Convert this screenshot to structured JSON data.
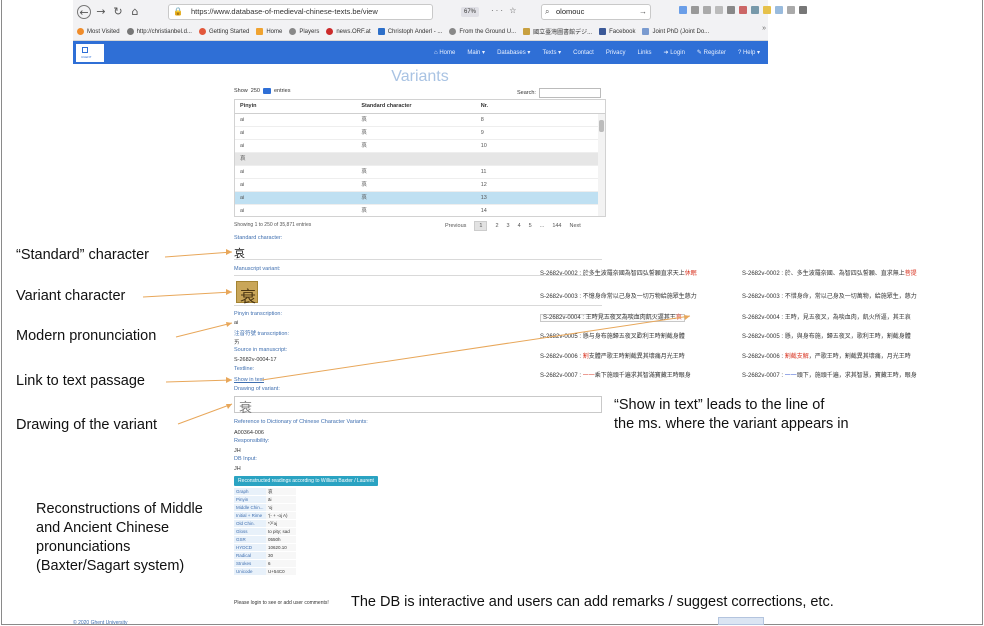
{
  "browser": {
    "url": "https://www.database-of-medieval-chinese-texts.be/view",
    "zoom": "67%",
    "search_value": "olomouc",
    "bookmarks": [
      "Most Visited",
      "http://christianbel.d...",
      "Getting Started",
      "Home",
      "Players",
      "news.ORF.at",
      "Christoph Anderl - ...",
      "From the Ground U...",
      "國立臺灣圖書館デジ...",
      "Facebook",
      "Joint PhD (Joint Do..."
    ]
  },
  "site_nav": {
    "items": [
      "Home",
      "Main",
      "Databases",
      "Texts",
      "Contact",
      "Privacy",
      "Links",
      "Login",
      "Register",
      "Help"
    ]
  },
  "page_title": "Variants",
  "datatable": {
    "show_label": "Show",
    "show_value": "250",
    "entries_label": "entries",
    "search_label": "Search:",
    "headers": [
      "Pinyin",
      "Standard character",
      "Nr."
    ],
    "rows": [
      {
        "pinyin": "ai",
        "char": "哀",
        "nr": "8"
      },
      {
        "pinyin": "ai",
        "char": "哀",
        "nr": "9"
      },
      {
        "pinyin": "ai",
        "char": "哀",
        "nr": "10"
      },
      {
        "pinyin": "哀",
        "char": "",
        "nr": ""
      },
      {
        "pinyin": "ai",
        "char": "哀",
        "nr": "11"
      },
      {
        "pinyin": "ai",
        "char": "哀",
        "nr": "12"
      },
      {
        "pinyin": "ai",
        "char": "哀",
        "nr": "13"
      },
      {
        "pinyin": "ai",
        "char": "哀",
        "nr": "14"
      }
    ],
    "info": "Showing 1 to 250 of 35,871 entries",
    "pager": [
      "Previous",
      "1",
      "2",
      "3",
      "4",
      "5",
      "...",
      "144",
      "Next"
    ]
  },
  "detail": {
    "standard_char_label": "Standard character:",
    "standard_char": "哀",
    "ms_variant_label": "Manuscript variant:",
    "ms_variant_char": "衰",
    "pinyin_label": "Pinyin transcription:",
    "pinyin_value": "ai",
    "zhuyin_label": "注音符號 transcription:",
    "zhuyin_value": "ㄞ",
    "source_label": "Source in manuscript:",
    "source_value": "S-2682v-0004-17",
    "textline_label": "Textline:",
    "show_in_text": "Show in text",
    "drawing_label": "Drawing of variant:",
    "drawing_char": "衰",
    "reference_label": "Reference to Dictionary of Chinese Character Variants:",
    "reference_value": "A00364-006",
    "responsibility_label": "Responsibility:",
    "responsibility_value": "JH",
    "db_input_label": "DB Input:",
    "db_input_value": "JH",
    "recon_button": "Reconstructed readings according to William Baxter / Laurent Sagart",
    "recon_rows": [
      {
        "k": "Graph",
        "v": "哀"
      },
      {
        "k": "Pinyin",
        "v": "āi"
      },
      {
        "k": "Middle Chin...",
        "v": "'oj"
      },
      {
        "k": "Initial + Rime",
        "v": "'(- + -oj A)"
      },
      {
        "k": "Old Chin.",
        "v": "*ʔˤəj"
      },
      {
        "k": "Gloss",
        "v": "to pity; sad"
      },
      {
        "k": "GSR",
        "v": "0550h"
      },
      {
        "k": "HYDCD",
        "v": "10620.10"
      },
      {
        "k": "Radical",
        "v": "30"
      },
      {
        "k": "Strokes",
        "v": "6"
      },
      {
        "k": "Unicode",
        "v": "U+54C0"
      }
    ],
    "login_note": "Please login to see or add user comments!"
  },
  "footer": {
    "left": "© 2020 Ghent University"
  },
  "passages_left": [
    {
      "id": "S-2682v-0002",
      "text": "於多生波羅奈國為智四弘誓願直求天上",
      "mark": "休眠",
      "color": "red"
    },
    {
      "id": "S-2682v-0003",
      "text": "不憶身命常以己身及一切万物給施眾生慈力",
      "mark": "",
      "color": ""
    },
    {
      "id": "S-2682v-0004",
      "text": "王時見五夜叉為啖血肉飢火逼其王",
      "mark": "哀",
      "color": "red"
    },
    {
      "id": "S-2682v-0005",
      "text": "懸与身布施歸五夜叉歡利王時割截身體",
      "mark": "",
      "color": ""
    },
    {
      "id": "S-2682v-0006",
      "text": "支體",
      "pre": "割",
      "rest": "严歌王時割截異其壞痛月光王時",
      "color": "red"
    },
    {
      "id": "S-2682v-0007",
      "text": "乘下施頭千遍求其智滿寶藏王時眼身",
      "pre": "一一",
      "color": "red"
    }
  ],
  "passages_right": [
    {
      "id": "S-2682v-0002",
      "text": "於、多生波羅奈國、為智四弘誓願、直求無上",
      "mark": "菩提",
      "color": "red"
    },
    {
      "id": "S-2682v-0003",
      "text": "不惜身命，常以己身及一切萬物，給施眾生，慈力",
      "mark": "",
      "color": ""
    },
    {
      "id": "S-2682v-0004",
      "text": "王時，見五夜叉，為啖血肉，飢火所逼，其王哀",
      "mark": "",
      "color": ""
    },
    {
      "id": "S-2682v-0005",
      "text": "懸，與身布施，歸五夜叉，歌利王時，割截身體",
      "mark": "",
      "color": ""
    },
    {
      "id": "S-2682v-0006",
      "text": "，严歌王時，割截異其壞痛，月光王時",
      "pre": "割截支解",
      "color": "red"
    },
    {
      "id": "S-2682v-0007",
      "text": "頭下，施頭千遍，求其智慧，寶藏王時，眼身",
      "pre": "一一",
      "color": "blue"
    }
  ],
  "annotations": {
    "standard": "“Standard” character",
    "variant": "Variant character",
    "pronunciation": "Modern pronunciation",
    "link": "Link to text passage",
    "drawing": "Drawing of the variant",
    "show_in_text_1": "“Show in text” leads to the line of",
    "show_in_text_2": "the ms. where the variant appears in",
    "recon_1": "Reconstructions of Middle",
    "recon_2": "and Ancient Chinese",
    "recon_3": "pronunciations",
    "recon_4": "(Baxter/Sagart system)",
    "interactive": "The DB is interactive and users can add remarks / suggest corrections, etc."
  },
  "colors": {
    "nav_blue": "#2f6fd6",
    "title_blue": "#a9c3e3",
    "button_teal": "#2aa3c2",
    "highlight_red": "#d8321f",
    "arrow_orange": "#e8a75a"
  }
}
